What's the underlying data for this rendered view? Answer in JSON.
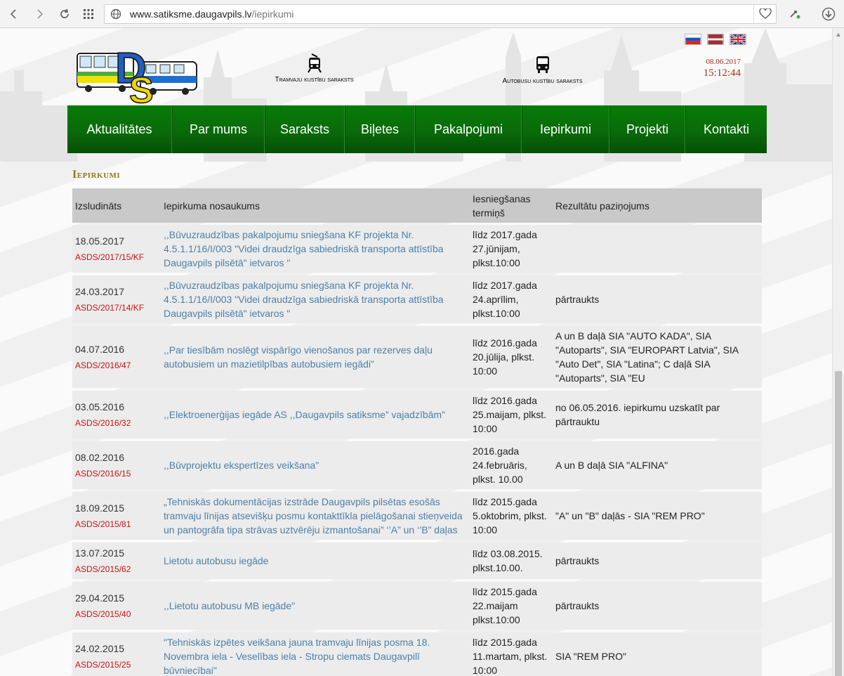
{
  "browser": {
    "url_host": "www.satiksme.daugavpils.lv",
    "url_path": "/iepirkumi"
  },
  "header": {
    "tram_label": "Tramvaju kustību saraksts",
    "bus_label": "Autobusu kustību saraksts",
    "date": "08.06.2017",
    "time": "15:12:44",
    "flags": [
      "ru",
      "lv",
      "en"
    ],
    "logo_text": "DS"
  },
  "menu": {
    "items": [
      {
        "label": "Aktualitātes"
      },
      {
        "label": "Par mums"
      },
      {
        "label": "Saraksts"
      },
      {
        "label": "Biļetes"
      },
      {
        "label": "Pakalpojumi"
      },
      {
        "label": "Iepirkumi"
      },
      {
        "label": "Projekti"
      },
      {
        "label": "Kontakti"
      }
    ]
  },
  "content": {
    "heading": "Iepirkumi",
    "columns": {
      "announced": "Izsludināts",
      "name": "Iepirkuma nosaukums",
      "deadline": "Iesniegšanas termiņš",
      "result": "Rezultātu paziņojums"
    },
    "rows": [
      {
        "date": "18.05.2017",
        "code": "ASDS/2017/15/KF",
        "title": ",,Būvuzraudzības pakalpojumu sniegšana KF projekta Nr. 4.5.1.1/16/I/003 \"Videi draudzīga sabiedriskā transporta attīstība Daugavpils pilsētā\" ietvaros \"",
        "deadline": "līdz 2017.gada 27.jūnijam, plkst.10:00",
        "result": ""
      },
      {
        "date": "24.03.2017",
        "code": "ASDS/2017/14/KF",
        "title": ",,Būvuzraudzības pakalpojumu sniegšana KF projekta Nr. 4.5.1.1/16/I/003 \"Videi draudzīga sabiedriskā transporta attīstība Daugavpils pilsētā\" ietvaros \"",
        "deadline": "līdz 2017.gada 24.aprīlim, plkst.10:00",
        "result": "pārtraukts"
      },
      {
        "date": "04.07.2016",
        "code": "ASDS/2016/47",
        "title": ",,Par tiesībām noslēgt vispārīgo vienošanos par rezerves daļu autobusiem un mazietilpības autobusiem iegādi”",
        "deadline": "līdz 2016.gada 20.jūlija, plkst. 10:00",
        "result": "A un B daļā SIA \"AUTO KADA\", SIA \"Autoparts\", SIA \"EUROPART Latvia\", SIA \"Auto Det\", SIA \"Latina\"; C daļā SIA \"Autoparts\", SIA \"EU"
      },
      {
        "date": "03.05.2016",
        "code": "ASDS/2016/32",
        "title": ",,Elektroenerģijas iegāde AS ,,Daugavpils satiksme” vajadzībām”",
        "deadline": "līdz 2016.gada 25.maijam, plkst. 10:00",
        "result": "no 06.05.2016. iepirkumu uzskatīt par pārtrauktu"
      },
      {
        "date": "08.02.2016",
        "code": "ASDS/2016/15",
        "title": ",,Būvprojektu ekspertīzes veikšana”",
        "deadline": "2016.gada 24.februāris, plkst. 10.00",
        "result": "A un B daļā SIA \"ALFINA\""
      },
      {
        "date": "18.09.2015",
        "code": "ASDS/2015/81",
        "title": "„Tehniskās dokumentācijas izstrāde Daugavpils pilsētas esošās tramvaju līnijas atsevišķu posmu kontakttīkla pielāgošanai stieņveida un pantogrāfa tipa strāvas uztvērēju izmantošanai” ‘’A” un ‘’B” daļas",
        "deadline": "līdz 2015.gada 5.oktobrim, plkst. 10:00",
        "result": "\"A\" un \"B\" daļās - SIA \"REM PRO\""
      },
      {
        "date": "13.07.2015",
        "code": "ASDS/2015/62",
        "title": "Lietotu autobusu iegāde",
        "deadline": "līdz 03.08.2015. plkst.10.00.",
        "result": "pārtraukts"
      },
      {
        "date": "29.04.2015",
        "code": "ASDS/2015/40",
        "title": ",,Lietotu autobusu MB iegāde\"",
        "deadline": "līdz 2015.gada 22.maijam plkst.10:00",
        "result": "pārtraukts"
      },
      {
        "date": "24.02.2015",
        "code": "ASDS/2015/25",
        "title": "\"Tehniskās izpētes veikšana jauna tramvaju līnijas posma 18. Novembra iela - Veselības iela - Stropu ciemats Daugavpilī būvniecībai\"",
        "deadline": "līdz 2015.gada 11.martam, plkst. 10:00",
        "result": "SIA \"REM PRO\""
      }
    ]
  }
}
